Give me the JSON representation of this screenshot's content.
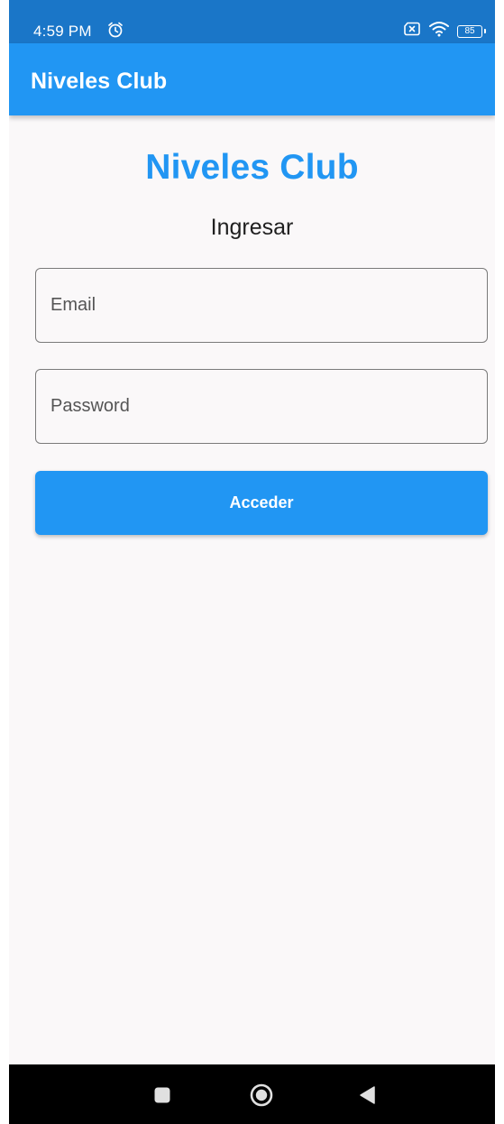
{
  "status_bar": {
    "time": "4:59 PM",
    "battery_level": "85",
    "icons": [
      "alarm-icon",
      "no-sim-icon",
      "wifi-icon",
      "battery-icon"
    ]
  },
  "app_bar": {
    "title": "Niveles Club"
  },
  "login": {
    "brand_title": "Niveles Club",
    "subtitle": "Ingresar",
    "email": {
      "placeholder": "Email",
      "value": ""
    },
    "password": {
      "placeholder": "Password",
      "value": ""
    },
    "submit_label": "Acceder"
  },
  "nav_bar": {
    "buttons": [
      "recents-icon",
      "home-icon",
      "back-icon"
    ]
  },
  "colors": {
    "primary": "#2196f3",
    "status_bar": "#1a76c8",
    "background": "#faf8f9",
    "outline": "#7a7a7a"
  }
}
